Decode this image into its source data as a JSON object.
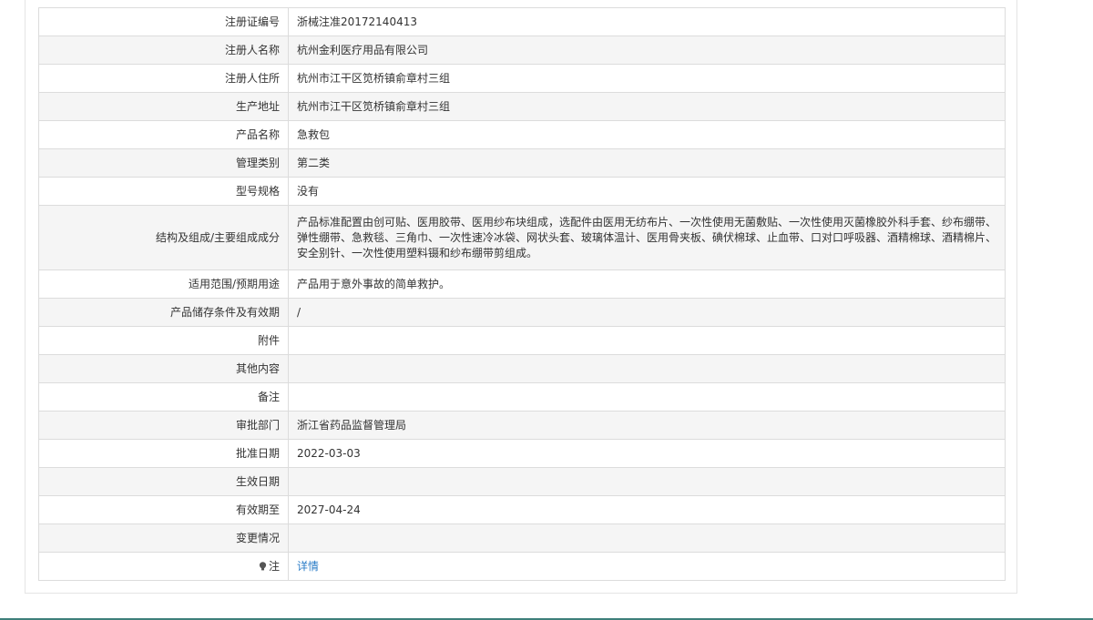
{
  "rows": [
    {
      "label": "注册证编号",
      "value": "浙械注准20172140413"
    },
    {
      "label": "注册人名称",
      "value": "杭州金利医疗用品有限公司"
    },
    {
      "label": "注册人住所",
      "value": "杭州市江干区笕桥镇俞章村三组"
    },
    {
      "label": "生产地址",
      "value": "杭州市江干区笕桥镇俞章村三组"
    },
    {
      "label": "产品名称",
      "value": "急救包"
    },
    {
      "label": "管理类别",
      "value": "第二类"
    },
    {
      "label": "型号规格",
      "value": "没有"
    },
    {
      "label": "结构及组成/主要组成成分",
      "value": "产品标准配置由创可贴、医用胶带、医用纱布块组成，选配件由医用无纺布片、一次性使用无菌敷贴、一次性使用灭菌橡胶外科手套、纱布绷带、弹性绷带、急救毯、三角巾、一次性速冷冰袋、网状头套、玻璃体温计、医用骨夹板、碘伏棉球、止血带、口对口呼吸器、酒精棉球、酒精棉片、安全别针、一次性使用塑料镊和纱布绷带剪组成。"
    },
    {
      "label": "适用范围/预期用途",
      "value": "产品用于意外事故的简单救护。"
    },
    {
      "label": "产品储存条件及有效期",
      "value": "/"
    },
    {
      "label": "附件",
      "value": ""
    },
    {
      "label": "其他内容",
      "value": ""
    },
    {
      "label": "备注",
      "value": ""
    },
    {
      "label": "审批部门",
      "value": "浙江省药品监督管理局"
    },
    {
      "label": "批准日期",
      "value": "2022-03-03"
    },
    {
      "label": "生效日期",
      "value": ""
    },
    {
      "label": "有效期至",
      "value": "2027-04-24"
    },
    {
      "label": "变更情况",
      "value": ""
    }
  ],
  "note_row": {
    "label": "注",
    "icon": "lightbulb-icon",
    "link_text": "详情"
  },
  "colors": {
    "link": "#2a7cc7",
    "border": "#dcdcdc",
    "stripe": "#f5f5f5",
    "bottom_bar": "#3e7f7a"
  }
}
